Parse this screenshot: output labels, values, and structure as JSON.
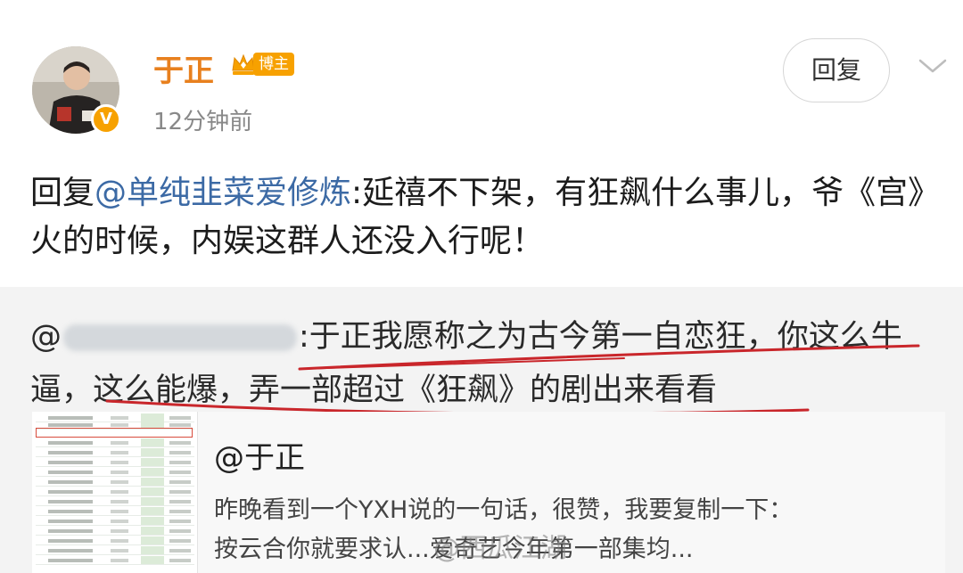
{
  "post": {
    "username": "于正",
    "badge_label": "博主",
    "timestamp": "12分钟前",
    "reply_button_label": "回复",
    "reply_prefix": "回复",
    "reply_mention": "@单纯韭菜爱修炼",
    "reply_body": ":延禧不下架，有狂飙什么事儿，爷《宫》火的时候，内娱这群人还没入行呢！"
  },
  "quote": {
    "at_sign": "@",
    "body": ":于正我愿称之为古今第一自恋狂，你这么牛逼，这么能爆，弄一部超过《狂飙》的剧出来看看"
  },
  "card": {
    "author": "@于正",
    "line1": "昨晚看到一个YXH说的一句话，很赞，我要复制一下：",
    "line2": "按云合你就要求认...爱奇艺今年第一部集均..."
  },
  "watermark": "@西瓜江湖"
}
